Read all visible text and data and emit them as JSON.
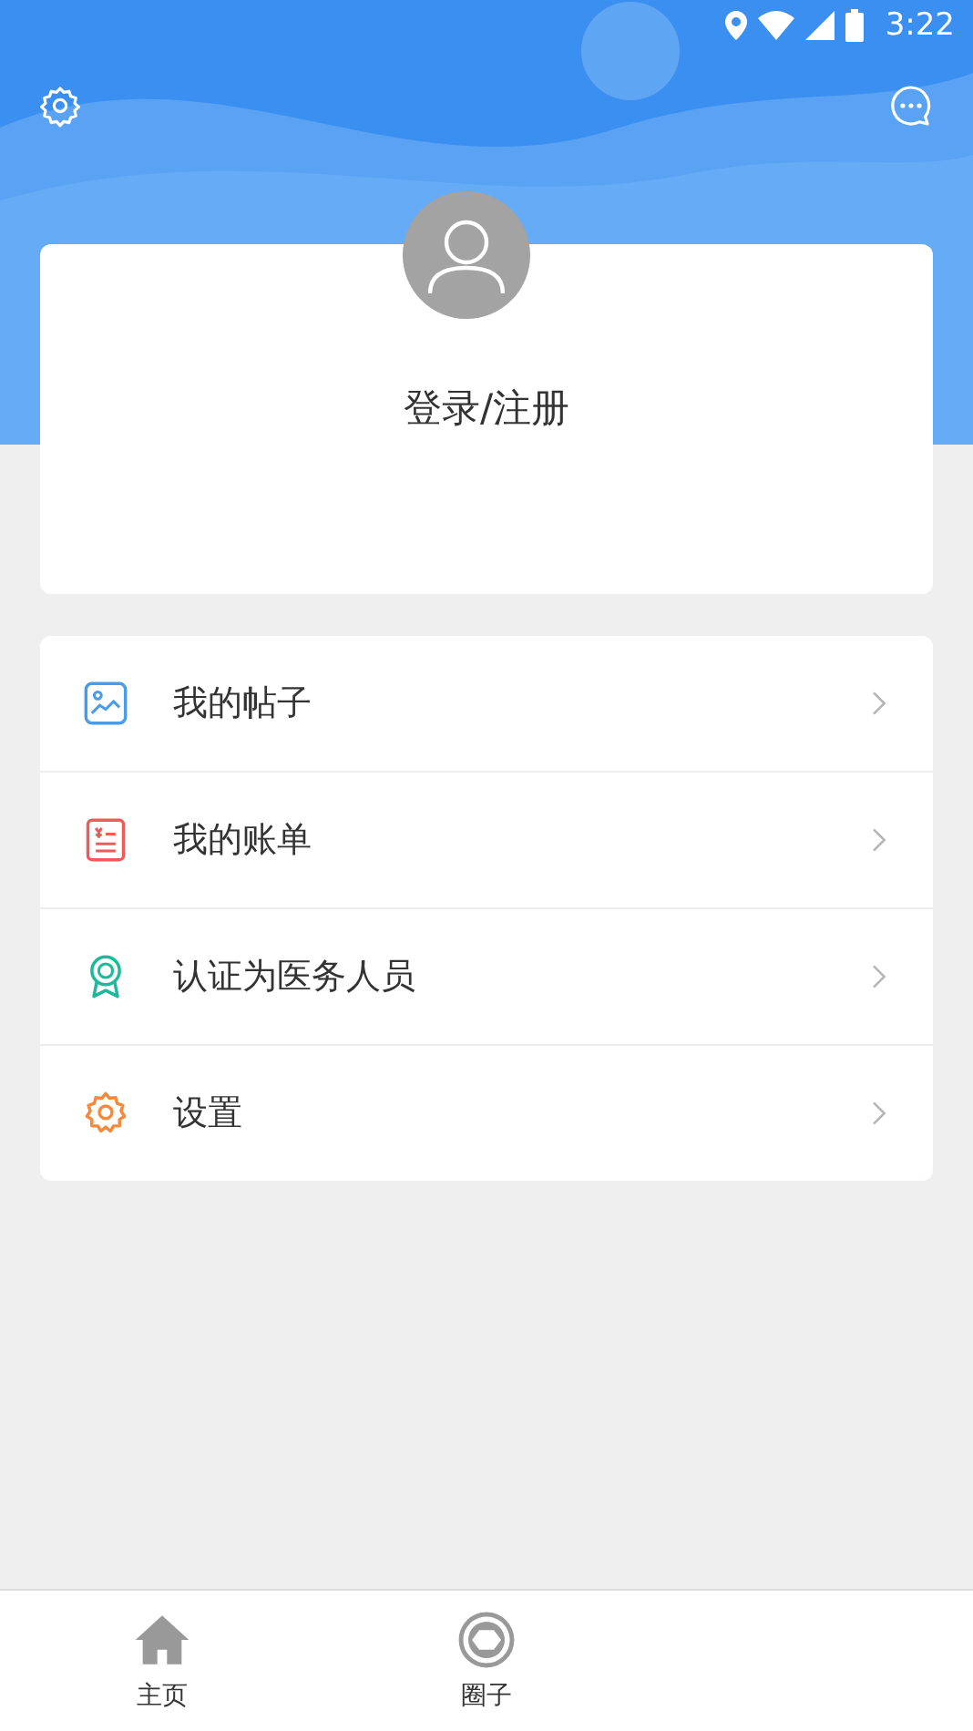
{
  "status_bar": {
    "time": "3:22"
  },
  "profile": {
    "login_label": "登录/注册"
  },
  "menu": [
    {
      "label": "我的帖子",
      "color": "#4a9be8"
    },
    {
      "label": "我的账单",
      "color": "#ef5a5a"
    },
    {
      "label": "认证为医务人员",
      "color": "#1fb89a"
    },
    {
      "label": "设置",
      "color": "#f58a3c"
    }
  ],
  "bottom_nav": [
    {
      "label": "主页",
      "selected": false
    },
    {
      "label": "圈子",
      "selected": false
    }
  ]
}
